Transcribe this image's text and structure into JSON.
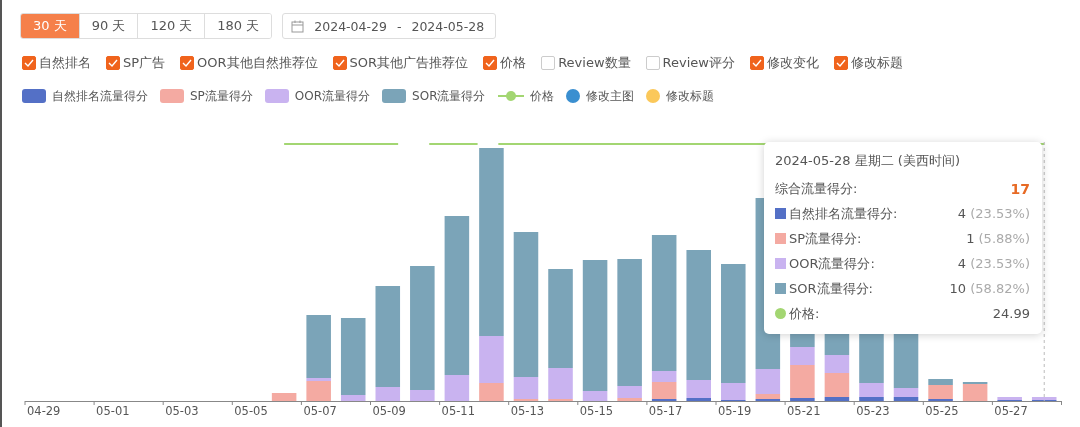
{
  "range_tabs": [
    {
      "label": "30 天",
      "selected": true
    },
    {
      "label": "90 天",
      "selected": false
    },
    {
      "label": "120 天",
      "selected": false
    },
    {
      "label": "180 天",
      "selected": false
    }
  ],
  "date_range": {
    "start": "2024-04-29",
    "separator": "-",
    "end": "2024-05-28"
  },
  "filters": [
    {
      "label": "自然排名",
      "checked": true
    },
    {
      "label": "SP广告",
      "checked": true
    },
    {
      "label": "OOR其他自然推荐位",
      "checked": true
    },
    {
      "label": "SOR其他广告推荐位",
      "checked": true
    },
    {
      "label": "价格",
      "checked": true
    },
    {
      "label": "Review数量",
      "checked": false
    },
    {
      "label": "Review评分",
      "checked": false
    },
    {
      "label": "修改变化",
      "checked": true
    },
    {
      "label": "修改标题",
      "checked": true
    }
  ],
  "legend": [
    {
      "label": "自然排名流量得分",
      "kind": "bar",
      "color": "#5470c6"
    },
    {
      "label": "SP流量得分",
      "kind": "bar",
      "color": "#f4aaa2"
    },
    {
      "label": "OOR流量得分",
      "kind": "bar",
      "color": "#c9b3f0"
    },
    {
      "label": "SOR流量得分",
      "kind": "bar",
      "color": "#7ba4b8"
    },
    {
      "label": "价格",
      "kind": "line",
      "color": "#a3d672"
    },
    {
      "label": "修改主图",
      "kind": "dot",
      "color": "#3a8fd0"
    },
    {
      "label": "修改标题",
      "kind": "dot",
      "color": "#fbc85a"
    }
  ],
  "x_labels": [
    "04-29",
    "05-01",
    "05-03",
    "05-05",
    "05-07",
    "05-09",
    "05-11",
    "05-13",
    "05-15",
    "05-17",
    "05-19",
    "05-21",
    "05-23",
    "05-25",
    "05-27"
  ],
  "tooltip": {
    "title": "2024-05-28 星期二 (美西时间)",
    "total_label": "综合流量得分:",
    "total_value": "17",
    "rows": [
      {
        "kind": "series",
        "label": "自然排名流量得分:",
        "value": "4",
        "percent": "(23.53%)",
        "color": "#5470c6"
      },
      {
        "kind": "series",
        "label": "SP流量得分:",
        "value": "1",
        "percent": "(5.88%)",
        "color": "#f4aaa2"
      },
      {
        "kind": "series",
        "label": "OOR流量得分:",
        "value": "4",
        "percent": "(23.53%)",
        "color": "#c9b3f0"
      },
      {
        "kind": "series",
        "label": "SOR流量得分:",
        "value": "10",
        "percent": "(58.82%)",
        "color": "#7ba4b8"
      },
      {
        "kind": "price",
        "label": "价格:",
        "value": "24.99",
        "color": "#a3d672"
      }
    ]
  }
}
